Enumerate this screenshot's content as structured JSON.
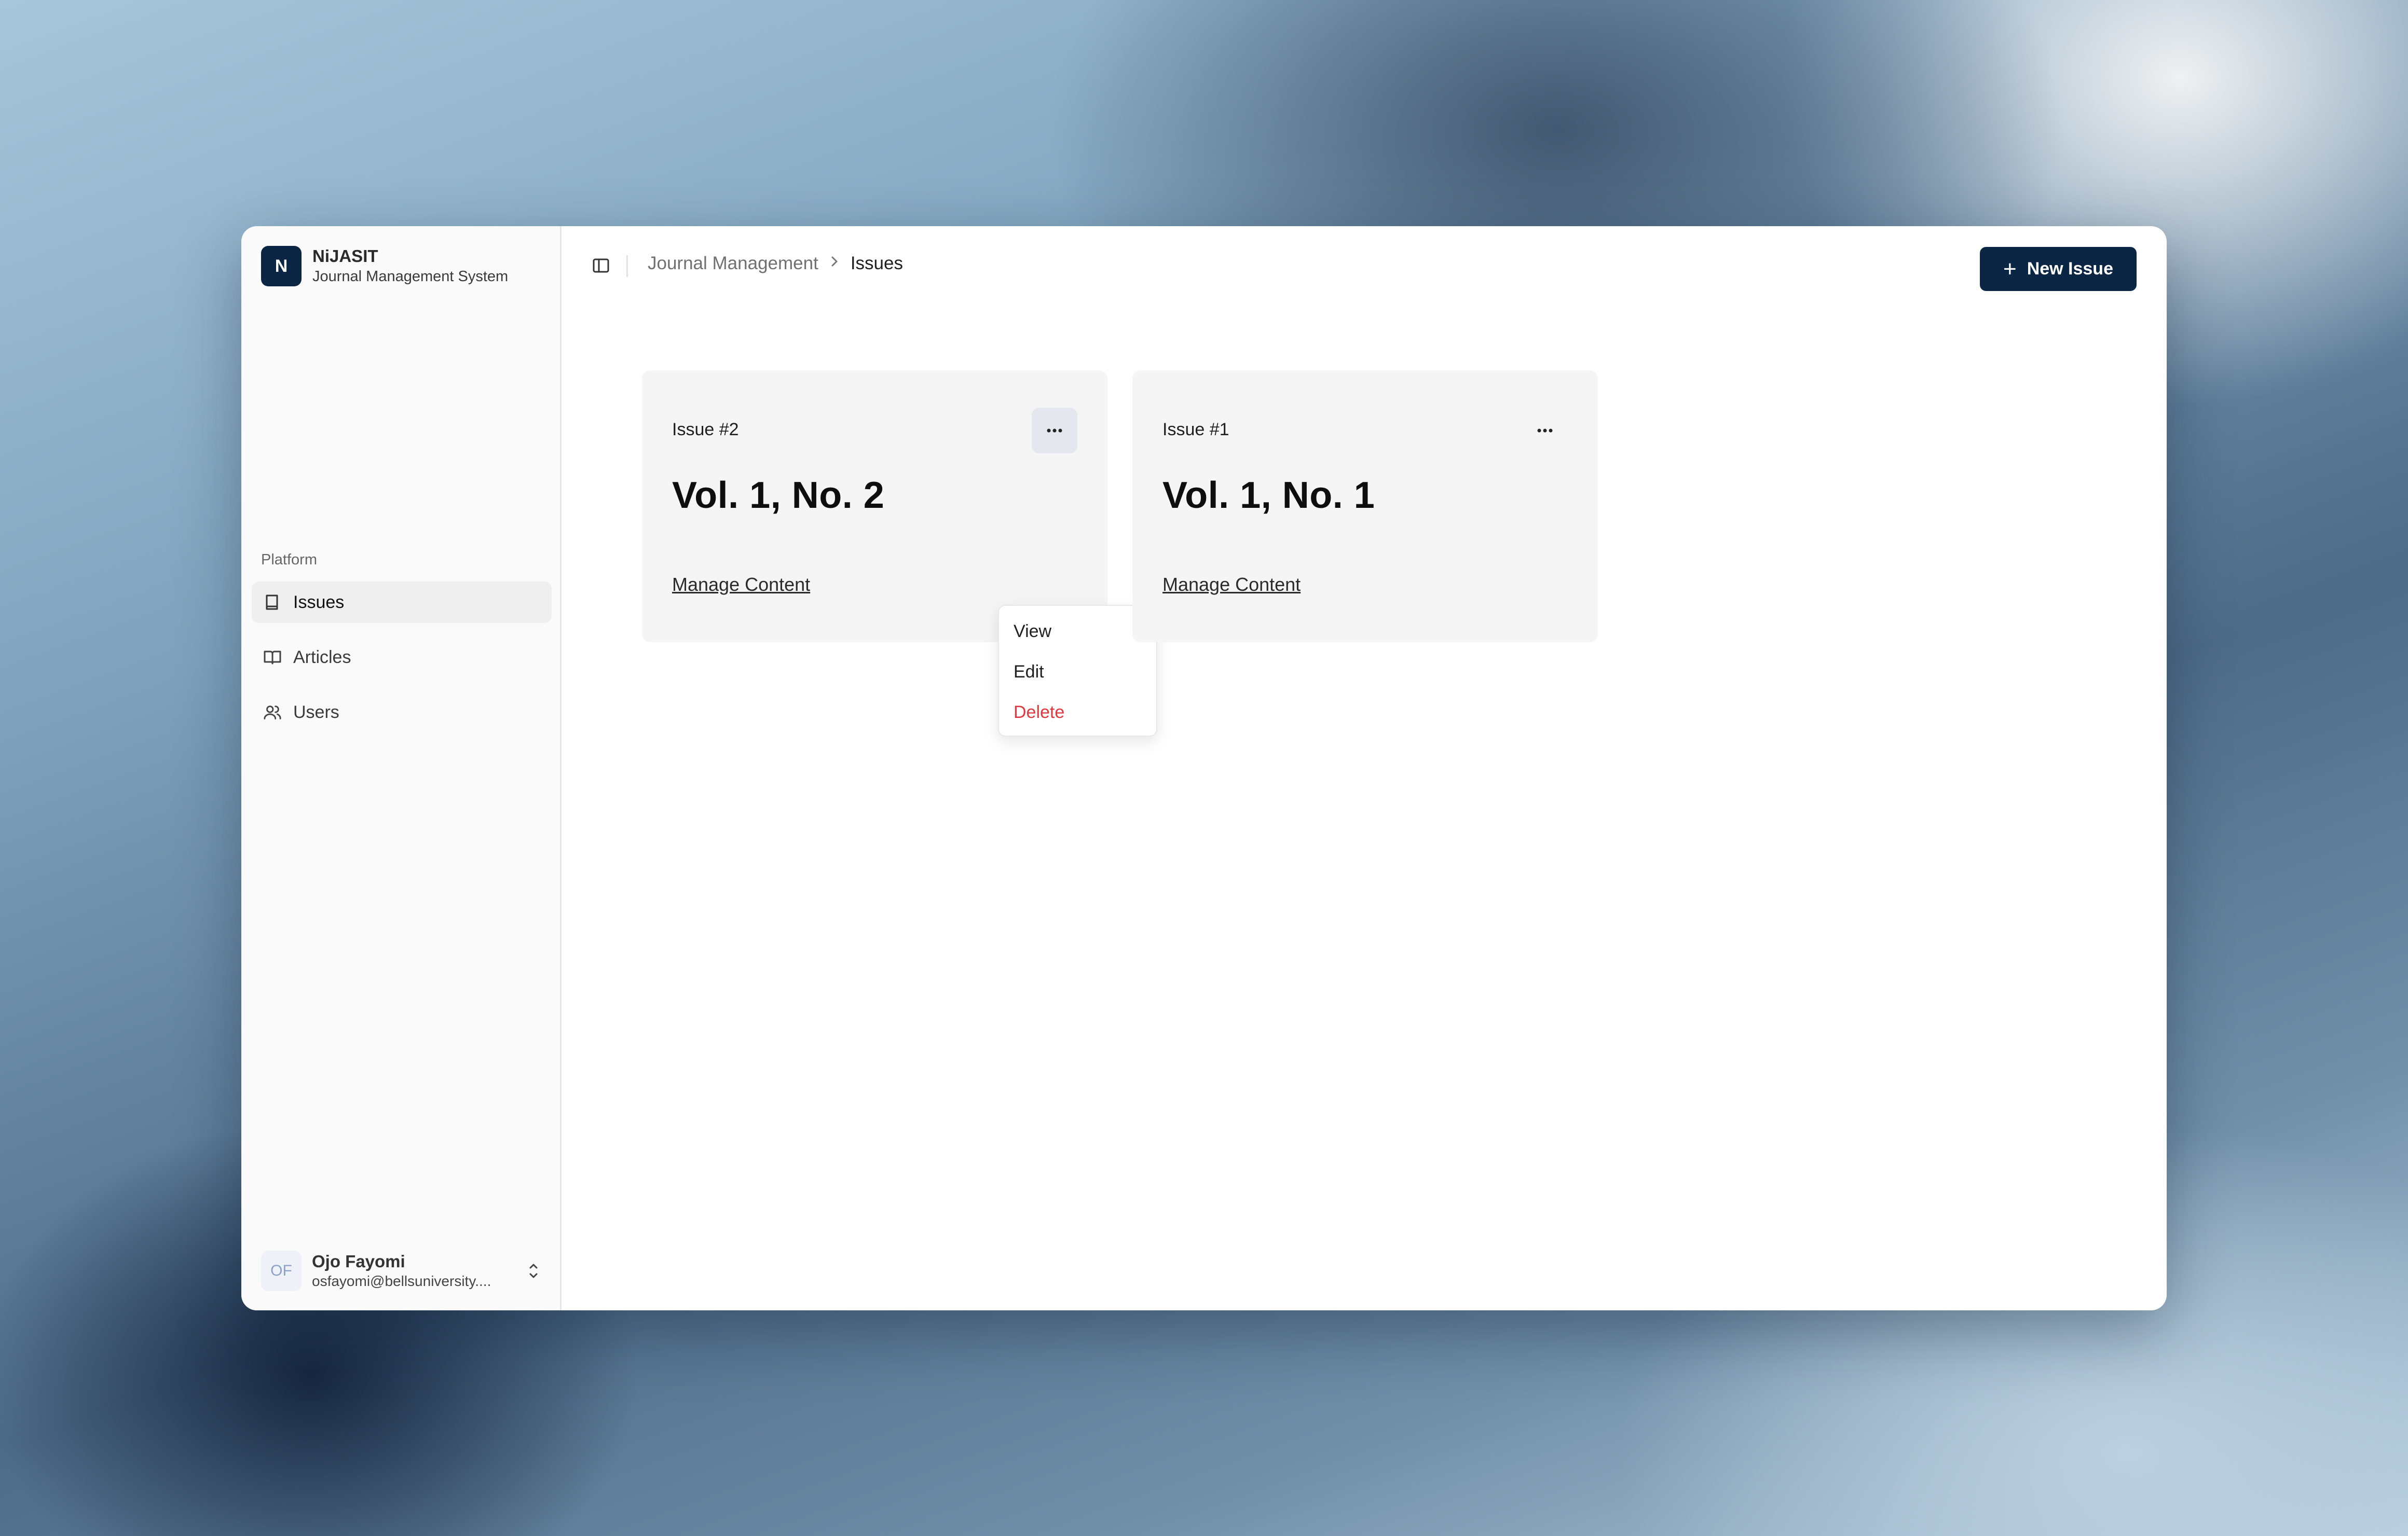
{
  "brand": {
    "logo_letter": "N",
    "name": "NiJASIT",
    "subtitle": "Journal Management System"
  },
  "sidebar": {
    "section_label": "Platform",
    "items": [
      {
        "label": "Issues",
        "icon": "book-icon",
        "active": true
      },
      {
        "label": "Articles",
        "icon": "book-open-icon",
        "active": false
      },
      {
        "label": "Users",
        "icon": "users-icon",
        "active": false
      }
    ]
  },
  "user": {
    "initials": "OF",
    "name": "Ojo Fayomi",
    "email": "osfayomi@bellsuniversity...."
  },
  "header": {
    "breadcrumb": [
      "Journal Management",
      "Issues"
    ],
    "new_button_label": "New Issue"
  },
  "cards": [
    {
      "label": "Issue #2",
      "title": "Vol. 1, No. 2",
      "link": "Manage Content"
    },
    {
      "label": "Issue #1",
      "title": "Vol. 1, No. 1",
      "link": "Manage Content"
    }
  ],
  "dropdown": {
    "items": [
      "View",
      "Edit",
      "Delete"
    ]
  },
  "colors": {
    "primary": "#0b2545",
    "danger": "#e0383e"
  }
}
